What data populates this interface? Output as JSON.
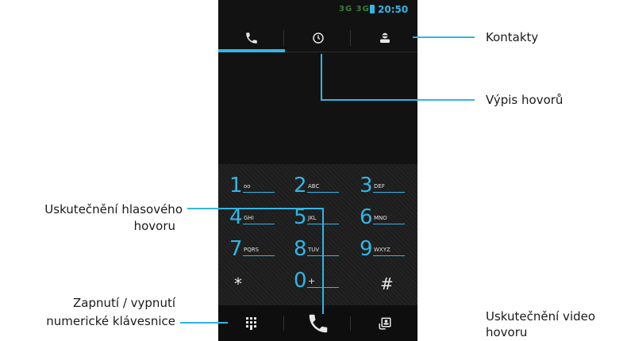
{
  "status_bar": {
    "time": "20:50",
    "signal": "3G 3G"
  },
  "tabs": [
    {
      "name": "phone",
      "icon": "phone-icon",
      "active": true
    },
    {
      "name": "recent",
      "icon": "clock-icon",
      "active": false
    },
    {
      "name": "contacts",
      "icon": "contact-icon",
      "active": false
    }
  ],
  "keys": [
    {
      "digit": "1",
      "letters": "oo"
    },
    {
      "digit": "2",
      "letters": "ABC"
    },
    {
      "digit": "3",
      "letters": "DEF"
    },
    {
      "digit": "4",
      "letters": "GHI"
    },
    {
      "digit": "5",
      "letters": "JKL"
    },
    {
      "digit": "6",
      "letters": "MNO"
    },
    {
      "digit": "7",
      "letters": "PQRS"
    },
    {
      "digit": "8",
      "letters": "TUV"
    },
    {
      "digit": "9",
      "letters": "WXYZ"
    },
    {
      "digit": "*",
      "letters": ""
    },
    {
      "digit": "0",
      "letters": "+"
    },
    {
      "digit": "#",
      "letters": ""
    }
  ],
  "callouts": {
    "contacts": "Kontakty",
    "call_log": "Výpis hovorů",
    "voice_call_1": "Uskutečnění hlasového",
    "voice_call_2": "hovoru",
    "keypad_toggle_1": "Zapnutí / vypnutí",
    "keypad_toggle_2": "numerické klávesnice",
    "video_call_1": "Uskutečnění video",
    "video_call_2": "hovoru"
  },
  "colors": {
    "accent": "#33b5e5",
    "background": "#121212"
  }
}
